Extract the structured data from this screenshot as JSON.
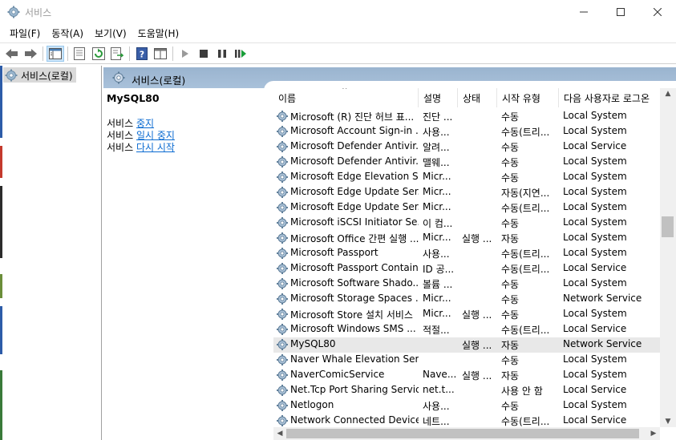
{
  "window": {
    "title": "서비스"
  },
  "menu": [
    "파일(F)",
    "동작(A)",
    "보기(V)",
    "도움말(H)"
  ],
  "menu_underline": [
    "F",
    "A",
    "V",
    "H"
  ],
  "tree": {
    "item": "서비스(로컬)"
  },
  "panel": {
    "header": "서비스(로컬)"
  },
  "description": {
    "service_name": "MySQL80",
    "prefix": "서비스",
    "actions": [
      "중지",
      "일시 중지",
      "다시 시작"
    ]
  },
  "columns": [
    "이름",
    "설명",
    "상태",
    "시작 유형",
    "다음 사용자로 로그온"
  ],
  "rows": [
    {
      "name": "Microsoft (R) 진단 허브 표...",
      "desc": "진단 ...",
      "status": "",
      "start": "수동",
      "logon": "Local System"
    },
    {
      "name": "Microsoft Account Sign-in ...",
      "desc": "사용...",
      "status": "",
      "start": "수동(트리...",
      "logon": "Local System"
    },
    {
      "name": "Microsoft Defender Antivir...",
      "desc": "알려...",
      "status": "",
      "start": "수동",
      "logon": "Local Service"
    },
    {
      "name": "Microsoft Defender Antivir...",
      "desc": "맬웨...",
      "status": "",
      "start": "수동",
      "logon": "Local System"
    },
    {
      "name": "Microsoft Edge Elevation S...",
      "desc": "Micr...",
      "status": "",
      "start": "수동",
      "logon": "Local System"
    },
    {
      "name": "Microsoft Edge Update Ser...",
      "desc": "Micr...",
      "status": "",
      "start": "자동(지연...",
      "logon": "Local System"
    },
    {
      "name": "Microsoft Edge Update Ser...",
      "desc": "Micr...",
      "status": "",
      "start": "수동(트리...",
      "logon": "Local System"
    },
    {
      "name": "Microsoft iSCSI Initiator Se...",
      "desc": "이 컴...",
      "status": "",
      "start": "수동",
      "logon": "Local System"
    },
    {
      "name": "Microsoft Office 간편 실행 ...",
      "desc": "Micr...",
      "status": "실행 ...",
      "start": "자동",
      "logon": "Local System"
    },
    {
      "name": "Microsoft Passport",
      "desc": "사용...",
      "status": "",
      "start": "수동(트리...",
      "logon": "Local System"
    },
    {
      "name": "Microsoft Passport Container",
      "desc": "ID 공...",
      "status": "",
      "start": "수동(트리...",
      "logon": "Local Service"
    },
    {
      "name": "Microsoft Software Shado...",
      "desc": "볼륨 ...",
      "status": "",
      "start": "수동",
      "logon": "Local System"
    },
    {
      "name": "Microsoft Storage Spaces ...",
      "desc": "Micr...",
      "status": "",
      "start": "수동",
      "logon": "Network Service"
    },
    {
      "name": "Microsoft Store 설치 서비스",
      "desc": "Micr...",
      "status": "실행 ...",
      "start": "수동",
      "logon": "Local System"
    },
    {
      "name": "Microsoft Windows SMS ...",
      "desc": "적절...",
      "status": "",
      "start": "수동(트리...",
      "logon": "Local Service"
    },
    {
      "name": "MySQL80",
      "desc": "",
      "status": "실행 ...",
      "start": "자동",
      "logon": "Network Service",
      "selected": true
    },
    {
      "name": "Naver Whale Elevation Serv...",
      "desc": "",
      "status": "",
      "start": "수동",
      "logon": "Local System"
    },
    {
      "name": "NaverComicService",
      "desc": "Nave...",
      "status": "실행 ...",
      "start": "자동",
      "logon": "Local System"
    },
    {
      "name": "Net.Tcp Port Sharing Service",
      "desc": "net.t...",
      "status": "",
      "start": "사용 안 함",
      "logon": "Local Service"
    },
    {
      "name": "Netlogon",
      "desc": "사용...",
      "status": "",
      "start": "수동",
      "logon": "Local System"
    },
    {
      "name": "Network Connected Device...",
      "desc": "네트...",
      "status": "",
      "start": "수동(트리...",
      "logon": "Local Service"
    }
  ],
  "icons": {
    "app": "gear-icon",
    "back": "back-arrow-icon",
    "forward": "forward-arrow-icon",
    "console_tree": "console-tree-icon",
    "properties": "properties-icon",
    "refresh": "refresh-icon",
    "export": "export-list-icon",
    "help": "help-icon",
    "view": "view-pane-icon",
    "start": "play-icon",
    "stop": "stop-icon",
    "pause": "pause-icon",
    "restart": "restart-icon",
    "service": "service-gear-icon"
  },
  "colors": {
    "header_band": "#9ab4cf",
    "link": "#0b6bd1",
    "selected_row": "#e8e8e8",
    "play_green": "#1a9e3a"
  }
}
